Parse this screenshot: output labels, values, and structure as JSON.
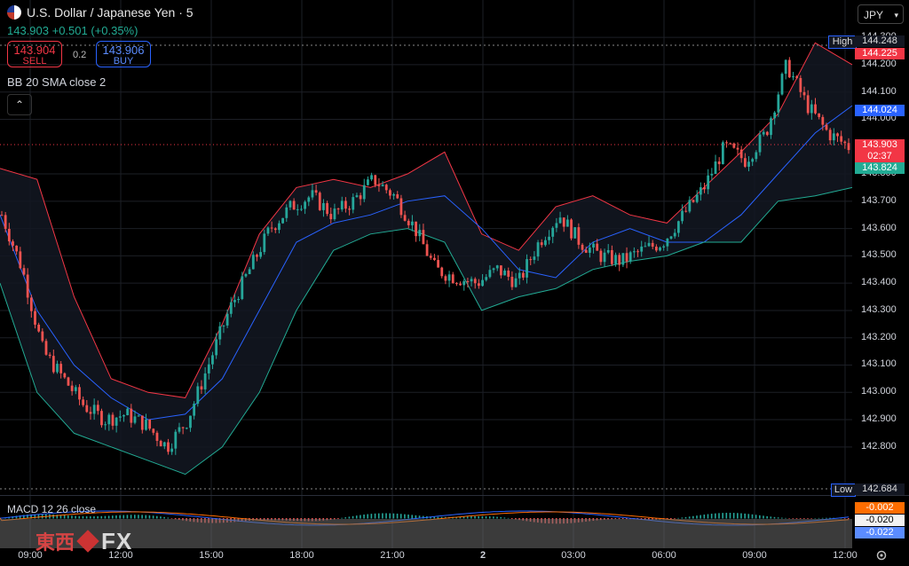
{
  "header": {
    "title": "U.S. Dollar / Japanese Yen · 5",
    "change": "143.903 +0.501 (+0.35%)"
  },
  "trade": {
    "sell_price": "143.904",
    "sell_label": "SELL",
    "spread": "0.2",
    "buy_price": "143.906",
    "buy_label": "BUY"
  },
  "indicator": {
    "label": "BB 20 SMA close 2",
    "collapse_icon": "chevron-up-icon"
  },
  "currency_select": "JPY",
  "price_axis": {
    "ticks": [
      "144.300",
      "144.200",
      "144.100",
      "144.000",
      "143.800",
      "143.700",
      "143.600",
      "143.500",
      "143.400",
      "143.300",
      "143.200",
      "143.100",
      "143.000",
      "142.900",
      "142.800"
    ],
    "high_label": "High",
    "high_value": "144.248",
    "bb_upper": "144.225",
    "bb_mid": "144.024",
    "last_price": "143.903",
    "countdown": "02:37",
    "bb_lower": "143.824",
    "low_label": "Low",
    "low_value": "142.684"
  },
  "macd": {
    "label": "MACD 12 26 close",
    "values": [
      "-0.002",
      "-0.020",
      "-0.022"
    ]
  },
  "time_axis": [
    "09:00",
    "12:00",
    "15:00",
    "18:00",
    "21:00",
    "2",
    "03:00",
    "06:00",
    "09:00",
    "12:00"
  ],
  "watermark": {
    "text1": "東西",
    "text2": "FX"
  },
  "colors": {
    "up": "#26a69a",
    "down": "#ef5350",
    "bb_upper": "#f23645",
    "bb_mid": "#2962ff",
    "bb_lower": "#22ab94",
    "background": "#000000"
  },
  "chart_data": {
    "type": "candlestick",
    "symbol": "USDJPY",
    "interval": "5",
    "ylim": [
      142.65,
      144.32
    ],
    "x": [
      "09:00",
      "12:00",
      "15:00",
      "18:00",
      "21:00",
      "2",
      "03:00",
      "06:00",
      "09:00",
      "12:00"
    ],
    "close_path": [
      143.65,
      143.45,
      143.15,
      143.05,
      142.95,
      142.9,
      142.92,
      142.88,
      142.8,
      142.9,
      143.1,
      143.3,
      143.45,
      143.6,
      143.68,
      143.72,
      143.65,
      143.7,
      143.78,
      143.72,
      143.6,
      143.45,
      143.42,
      143.4,
      143.45,
      143.4,
      143.55,
      143.65,
      143.55,
      143.5,
      143.48,
      143.52,
      143.55,
      143.65,
      143.75,
      143.9,
      143.85,
      143.95,
      144.2,
      144.05,
      143.95,
      143.9
    ],
    "series": [
      {
        "name": "BB upper",
        "values": [
          143.82,
          143.78,
          143.35,
          143.05,
          143.0,
          142.98,
          143.25,
          143.58,
          143.75,
          143.78,
          143.75,
          143.8,
          143.88,
          143.58,
          143.52,
          143.68,
          143.72,
          143.65,
          143.62,
          143.75,
          143.88,
          144.02,
          144.28,
          144.2
        ]
      },
      {
        "name": "BB basis",
        "values": [
          143.65,
          143.3,
          143.1,
          142.98,
          142.9,
          142.92,
          143.05,
          143.3,
          143.55,
          143.62,
          143.65,
          143.7,
          143.72,
          143.6,
          143.45,
          143.42,
          143.55,
          143.6,
          143.55,
          143.55,
          143.65,
          143.8,
          143.95,
          144.05
        ]
      },
      {
        "name": "BB lower",
        "values": [
          143.4,
          143.0,
          142.85,
          142.8,
          142.75,
          142.7,
          142.8,
          143.0,
          143.3,
          143.52,
          143.58,
          143.6,
          143.55,
          143.3,
          143.35,
          143.38,
          143.45,
          143.48,
          143.5,
          143.55,
          143.55,
          143.7,
          143.72,
          143.75
        ]
      }
    ]
  }
}
